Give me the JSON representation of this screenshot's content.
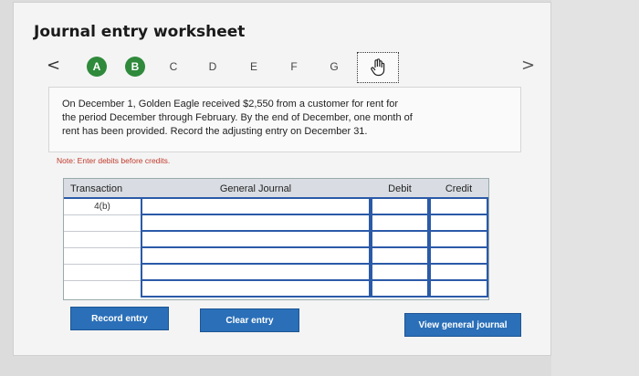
{
  "title": "Journal entry worksheet",
  "nav": {
    "prev": "<",
    "next": ">"
  },
  "steps": [
    {
      "label": "A",
      "status": "complete"
    },
    {
      "label": "B",
      "status": "complete"
    },
    {
      "label": "C",
      "status": "pending"
    },
    {
      "label": "D",
      "status": "pending"
    },
    {
      "label": "E",
      "status": "pending"
    },
    {
      "label": "F",
      "status": "pending"
    },
    {
      "label": "G",
      "status": "pending"
    },
    {
      "label": "",
      "status": "current",
      "icon": "hand-pointer-icon"
    }
  ],
  "prompt": {
    "line1": "On December 1, Golden Eagle received $2,550 from a customer for rent for",
    "line2": "the period December through February. By the end of December, one month of",
    "line3": "rent has been provided. Record the adjusting entry on December 31."
  },
  "note": "Note: Enter debits before credits.",
  "journal": {
    "headers": {
      "transaction": "Transaction",
      "general_journal": "General Journal",
      "debit": "Debit",
      "credit": "Credit"
    },
    "rows": [
      {
        "transaction": "4(b)",
        "account": "",
        "debit": "",
        "credit": ""
      },
      {
        "transaction": "",
        "account": "",
        "debit": "",
        "credit": ""
      },
      {
        "transaction": "",
        "account": "",
        "debit": "",
        "credit": ""
      },
      {
        "transaction": "",
        "account": "",
        "debit": "",
        "credit": ""
      },
      {
        "transaction": "",
        "account": "",
        "debit": "",
        "credit": ""
      },
      {
        "transaction": "",
        "account": "",
        "debit": "",
        "credit": ""
      }
    ]
  },
  "buttons": {
    "record": "Record entry",
    "clear": "Clear entry",
    "view": "View general journal"
  },
  "colors": {
    "complete": "#2f8a3b",
    "accent": "#2a6fb8",
    "note": "#c0392b"
  }
}
